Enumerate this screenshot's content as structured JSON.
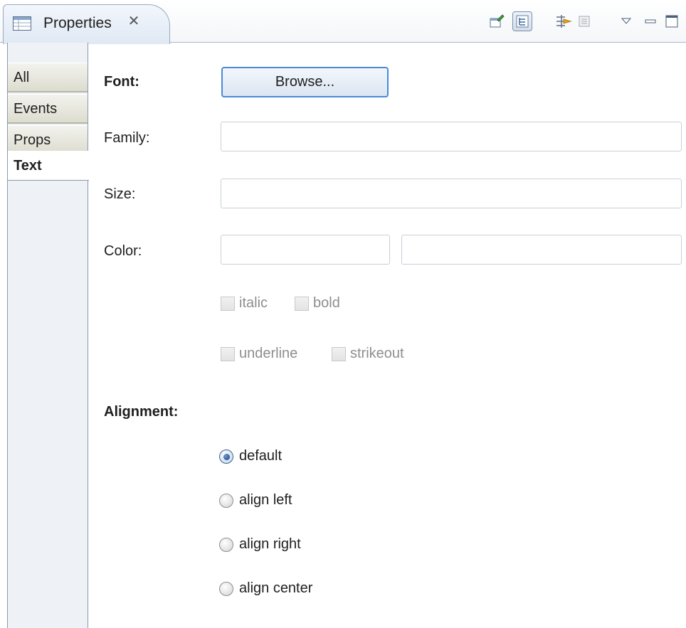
{
  "view": {
    "title": "Properties",
    "close_glyph": "✕",
    "toolbar": [
      {
        "name": "pin-editor-icon",
        "pressed": false
      },
      {
        "name": "categories-icon",
        "pressed": true
      },
      {
        "name": "advanced-icon",
        "pressed": false
      },
      {
        "name": "restore-default-icon",
        "pressed": false
      },
      {
        "name": "view-menu-icon",
        "pressed": false
      },
      {
        "name": "minimize-icon",
        "pressed": false
      },
      {
        "name": "maximize-icon",
        "pressed": false
      }
    ]
  },
  "side_tabs": [
    {
      "label": "All",
      "active": false
    },
    {
      "label": "Events",
      "active": false
    },
    {
      "label": "Props",
      "active": false
    },
    {
      "label": "Text",
      "active": true
    }
  ],
  "form": {
    "font_label": "Font:",
    "browse_label": "Browse...",
    "family_label": "Family:",
    "family_value": "",
    "size_label": "Size:",
    "size_value": "",
    "color_label": "Color:",
    "color_value_1": "",
    "color_value_2": "",
    "italic_label": "italic",
    "bold_label": "bold",
    "underline_label": "underline",
    "strikeout_label": "strikeout",
    "alignment_label": "Alignment:",
    "align_options": [
      {
        "label": "default",
        "selected": true
      },
      {
        "label": "align left",
        "selected": false
      },
      {
        "label": "align right",
        "selected": false
      },
      {
        "label": "align center",
        "selected": false
      }
    ]
  },
  "colors": {
    "selection_border": "#4a8ad8",
    "tab_border": "#99aac0"
  }
}
